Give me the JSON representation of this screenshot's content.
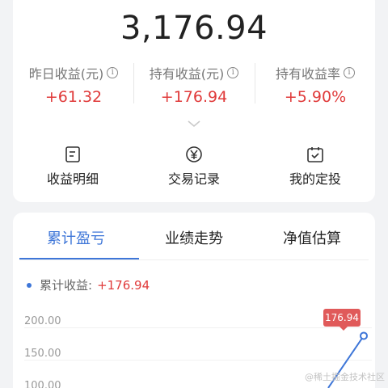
{
  "holding": {
    "total_value": "3,176.94",
    "stats": [
      {
        "label": "昨日收益(元)",
        "value": "+61.32"
      },
      {
        "label": "持有收益(元)",
        "value": "+176.94"
      },
      {
        "label": "持有收益率",
        "value": "+5.90%"
      }
    ],
    "info_glyph": "i"
  },
  "actions": [
    {
      "label": "收益明细",
      "icon": "document-icon"
    },
    {
      "label": "交易记录",
      "icon": "yen-coin-icon"
    },
    {
      "label": "我的定投",
      "icon": "calendar-check-icon"
    }
  ],
  "tabs": [
    {
      "label": "累计盈亏",
      "active": true
    },
    {
      "label": "业绩走势",
      "active": false
    },
    {
      "label": "净值估算",
      "active": false
    }
  ],
  "chart": {
    "legend_label": "累计收益:",
    "legend_value": "+176.94",
    "tooltip": "176.94",
    "line_color": "#3e76d8"
  },
  "chart_data": {
    "type": "line",
    "yticks": [
      "200.00",
      "150.00",
      "100.00"
    ],
    "series": [
      {
        "name": "累计收益",
        "values": [
          176.94
        ]
      }
    ],
    "last_point_value": 176.94
  },
  "colors": {
    "accent": "#3e76d8",
    "gain": "#e03a3a"
  },
  "watermark": "@稀土掘金技术社区"
}
